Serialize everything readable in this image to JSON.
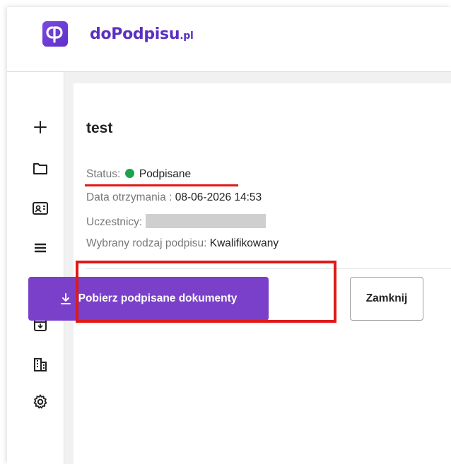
{
  "brand": {
    "name": "doPodpisu",
    "tld": ".pl"
  },
  "sidebar": {
    "items": [
      {
        "icon": "plus-icon"
      },
      {
        "icon": "folder-icon"
      },
      {
        "icon": "contact-card-icon"
      },
      {
        "icon": "list-icon"
      },
      {
        "icon": "shield-check-icon"
      },
      {
        "icon": "archive-download-icon"
      },
      {
        "icon": "building-icon"
      },
      {
        "icon": "gear-icon"
      }
    ]
  },
  "document": {
    "title": "test",
    "status_label": "Status:",
    "status_value": "Podpisane",
    "status_color": "#1ba34c",
    "received_label": "Data otrzymania :",
    "received_value": "08-06-2026 14:53",
    "participants_label": "Uczestnicy:",
    "signature_type_label": "Wybrany rodzaj podpisu:",
    "signature_type_value": "Kwalifikowany"
  },
  "actions": {
    "download_label": "Pobierz podpisane dokumenty",
    "close_label": "Zamknij"
  },
  "colors": {
    "accent": "#7b40c9",
    "highlight": "#e01818"
  }
}
